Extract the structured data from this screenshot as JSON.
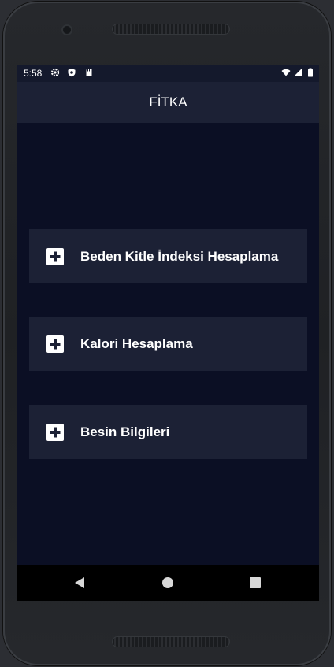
{
  "status_bar": {
    "time": "5:58",
    "left_icons": [
      "gear-icon",
      "shield-icon",
      "sd-card-icon"
    ],
    "right_icons": [
      "wifi-icon",
      "signal-icon",
      "battery-icon"
    ]
  },
  "app_bar": {
    "title": "FİTKA"
  },
  "menu": {
    "items": [
      {
        "label": "Beden Kitle İndeksi Hesaplama",
        "icon": "medical-plus-icon"
      },
      {
        "label": "Kalori Hesaplama",
        "icon": "medical-plus-icon"
      },
      {
        "label": "Besin Bilgileri",
        "icon": "medical-plus-icon"
      }
    ]
  },
  "nav_bar": {
    "buttons": [
      "back-icon",
      "home-icon",
      "recents-icon"
    ]
  },
  "colors": {
    "background": "#0b0f24",
    "app_bar": "#1c2135",
    "card": "#1c2135",
    "text": "#ffffff"
  }
}
